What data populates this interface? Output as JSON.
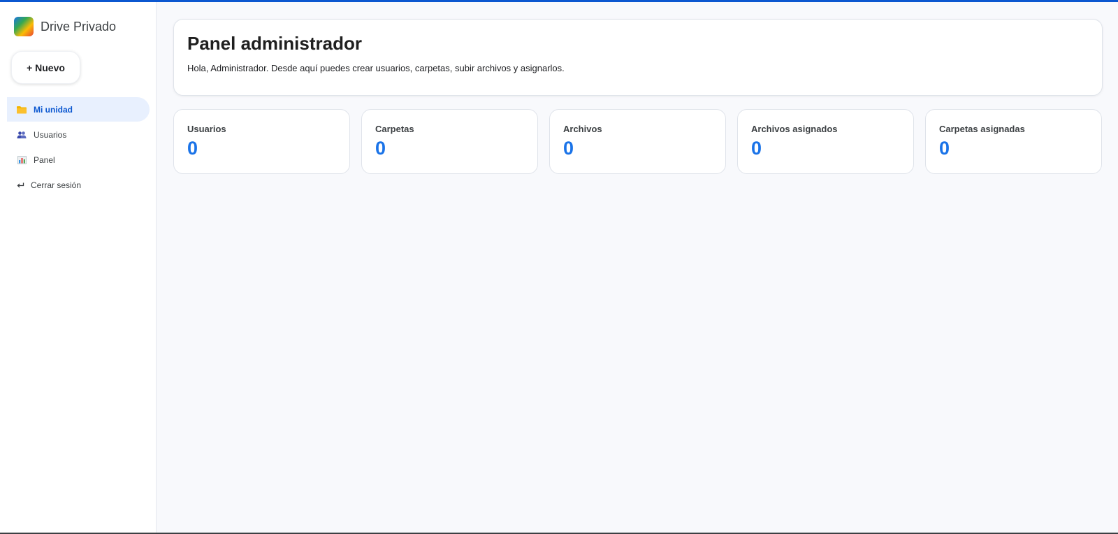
{
  "brand": {
    "name": "Drive Privado",
    "logo_icon": "drive-logo-icon"
  },
  "sidebar": {
    "new_button": "+ Nuevo",
    "items": [
      {
        "label": "Mi unidad",
        "icon": "folder-icon",
        "active": true
      },
      {
        "label": "Usuarios",
        "icon": "users-icon",
        "active": false
      },
      {
        "label": "Panel",
        "icon": "bar-chart-icon",
        "active": false
      }
    ],
    "logout": {
      "label": "Cerrar sesión",
      "icon": "logout-icon"
    }
  },
  "main": {
    "title": "Panel administrador",
    "subtitle": "Hola, Administrador. Desde aquí puedes crear usuarios, carpetas, subir archivos y asignarlos.",
    "stats": [
      {
        "label": "Usuarios",
        "value": "0"
      },
      {
        "label": "Carpetas",
        "value": "0"
      },
      {
        "label": "Archivos",
        "value": "0"
      },
      {
        "label": "Archivos asignados",
        "value": "0"
      },
      {
        "label": "Carpetas asignadas",
        "value": "0"
      }
    ]
  },
  "colors": {
    "accent": "#1a73e8",
    "active_nav_bg": "#e8f0fe",
    "active_nav_text": "#0b57d0",
    "top_bar": "#0b57d0",
    "page_bg": "#f8f9fc"
  }
}
